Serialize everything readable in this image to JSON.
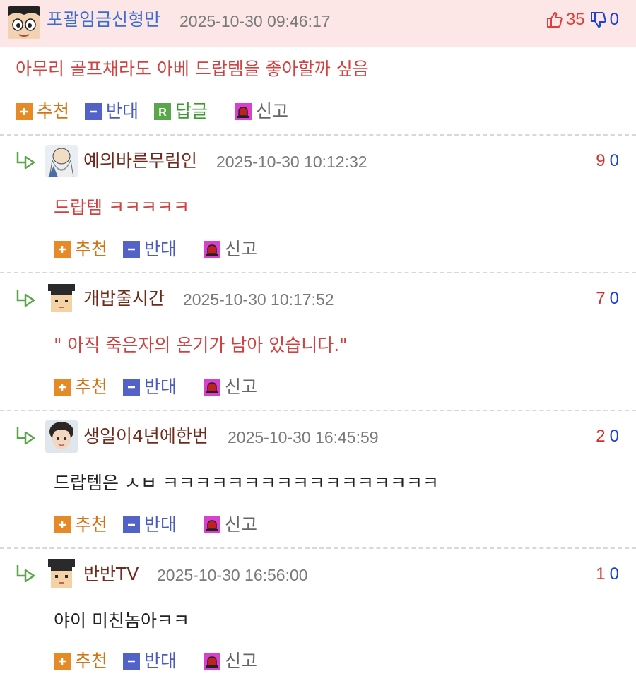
{
  "main": {
    "author": "포괄임금신형만",
    "date": "2025-10-30 09:46:17",
    "likes": "35",
    "dislikes": "0",
    "text": "아무리 골프채라도 아베 드랍템을 좋아할까 싶음",
    "actions": {
      "recommend": "추천",
      "oppose": "반대",
      "reply": "답글",
      "report": "신고"
    }
  },
  "replies": [
    {
      "author": "예의바른무림인",
      "date": "2025-10-30 10:12:32",
      "likes": "9",
      "dislikes": "0",
      "text": "드랍템 ㅋㅋㅋㅋㅋ",
      "recommend": "추천",
      "oppose": "반대",
      "report": "신고"
    },
    {
      "author": "개밥줄시간",
      "date": "2025-10-30 10:17:52",
      "likes": "7",
      "dislikes": "0",
      "text": "\" 아직 죽은자의 온기가 남아 있습니다.\"",
      "recommend": "추천",
      "oppose": "반대",
      "report": "신고"
    },
    {
      "author": "생일이4년에한번",
      "date": "2025-10-30 16:45:59",
      "likes": "2",
      "dislikes": "0",
      "text": "드랍템은 ㅅㅂ ㅋㅋㅋㅋㅋㅋㅋㅋㅋㅋㅋㅋㅋㅋㅋㅋㅋ",
      "recommend": "추천",
      "oppose": "반대",
      "report": "신고"
    },
    {
      "author": "반반TV",
      "date": "2025-10-30 16:56:00",
      "likes": "1",
      "dislikes": "0",
      "text": "야이 미친놈아ㅋㅋ",
      "recommend": "추천",
      "oppose": "반대",
      "report": "신고"
    }
  ],
  "colors": {
    "header_bg": "#fce6e6",
    "author_main": "#3a6dd0",
    "author_reply": "#702a1c",
    "like": "#e03c3c",
    "dislike": "#1c3fd6",
    "recommend": "#e58a26",
    "oppose": "#5262c6",
    "reply": "#5aa64a",
    "report": "#d940d0"
  },
  "icons": [
    "thumbs-up-icon",
    "thumbs-down-icon",
    "plus-icon",
    "minus-icon",
    "reply-icon",
    "siren-icon",
    "reply-arrow-icon"
  ]
}
